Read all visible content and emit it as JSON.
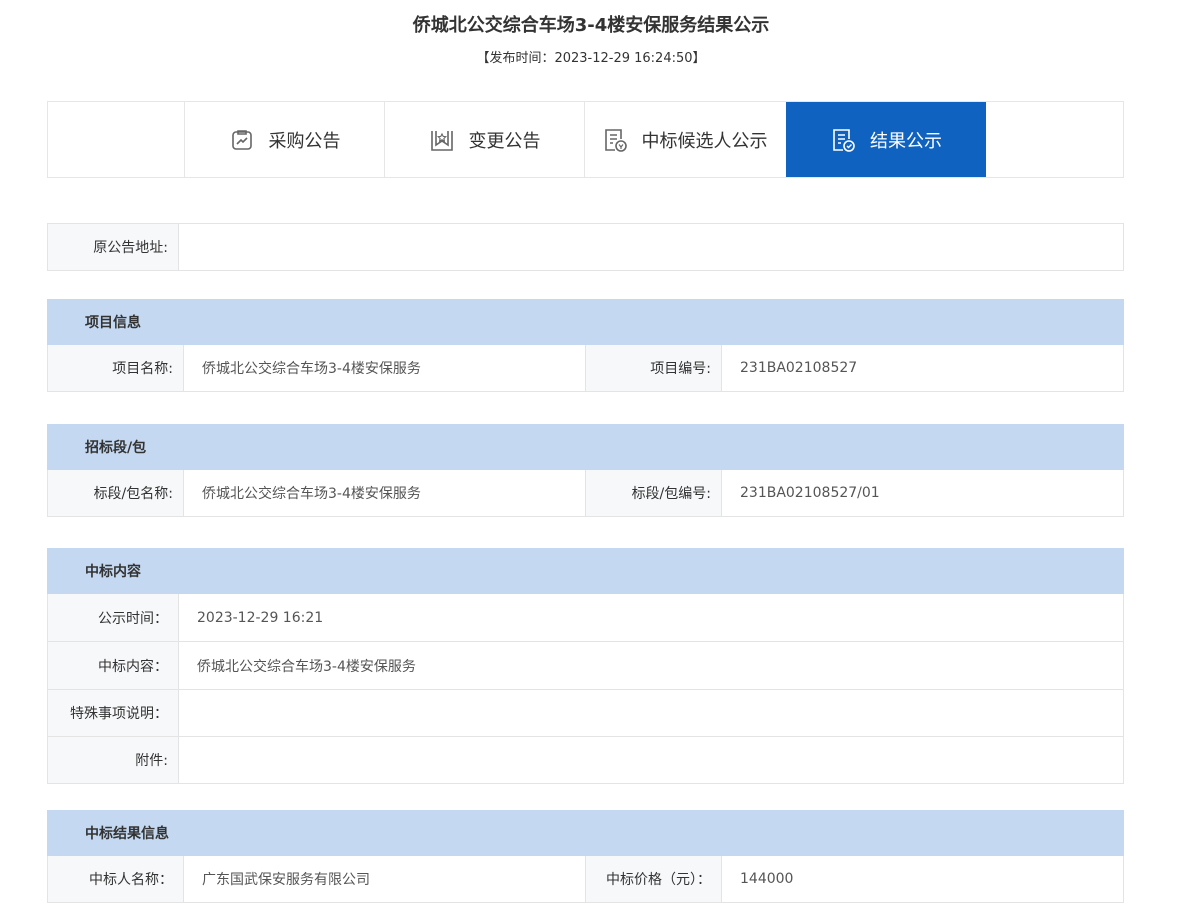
{
  "page": {
    "title": "侨城北公交综合车场3-4楼安保服务结果公示",
    "publish_time": "【发布时间：2023-12-29 16:24:50】"
  },
  "tabs": [
    {
      "label": "采购公告",
      "icon": "clipboard-icon",
      "active": false
    },
    {
      "label": "变更公告",
      "icon": "star-bookmark-icon",
      "active": false
    },
    {
      "label": "中标候选人公示",
      "icon": "document-badge-icon",
      "active": false
    },
    {
      "label": "结果公示",
      "icon": "document-check-icon",
      "active": true
    }
  ],
  "original_address": {
    "label": "原公告地址:",
    "value": ""
  },
  "project_info": {
    "header": "项目信息",
    "name_label": "项目名称:",
    "name_value": "侨城北公交综合车场3-4楼安保服务",
    "code_label": "项目编号:",
    "code_value": "231BA02108527"
  },
  "bid_section": {
    "header": "招标段/包",
    "name_label": "标段/包名称:",
    "name_value": "侨城北公交综合车场3-4楼安保服务",
    "code_label": "标段/包编号:",
    "code_value": "231BA02108527/01"
  },
  "award_content": {
    "header": "中标内容",
    "time_label": "公示时间：",
    "time_value": "2023-12-29 16:21",
    "content_label": "中标内容：",
    "content_value": "侨城北公交综合车场3-4楼安保服务",
    "special_label": "特殊事项说明：",
    "special_value": "",
    "attachment_label": "附件:",
    "attachment_value": ""
  },
  "award_result": {
    "header": "中标结果信息",
    "winner_label": "中标人名称：",
    "winner_value": "广东国武保安服务有限公司",
    "price_label": "中标价格（元）：",
    "price_value": "144000"
  },
  "colors": {
    "tab_active_bg": "#0f62bf",
    "section_header_bg": "#c4d9f1",
    "label_bg": "#f7f8fa"
  }
}
